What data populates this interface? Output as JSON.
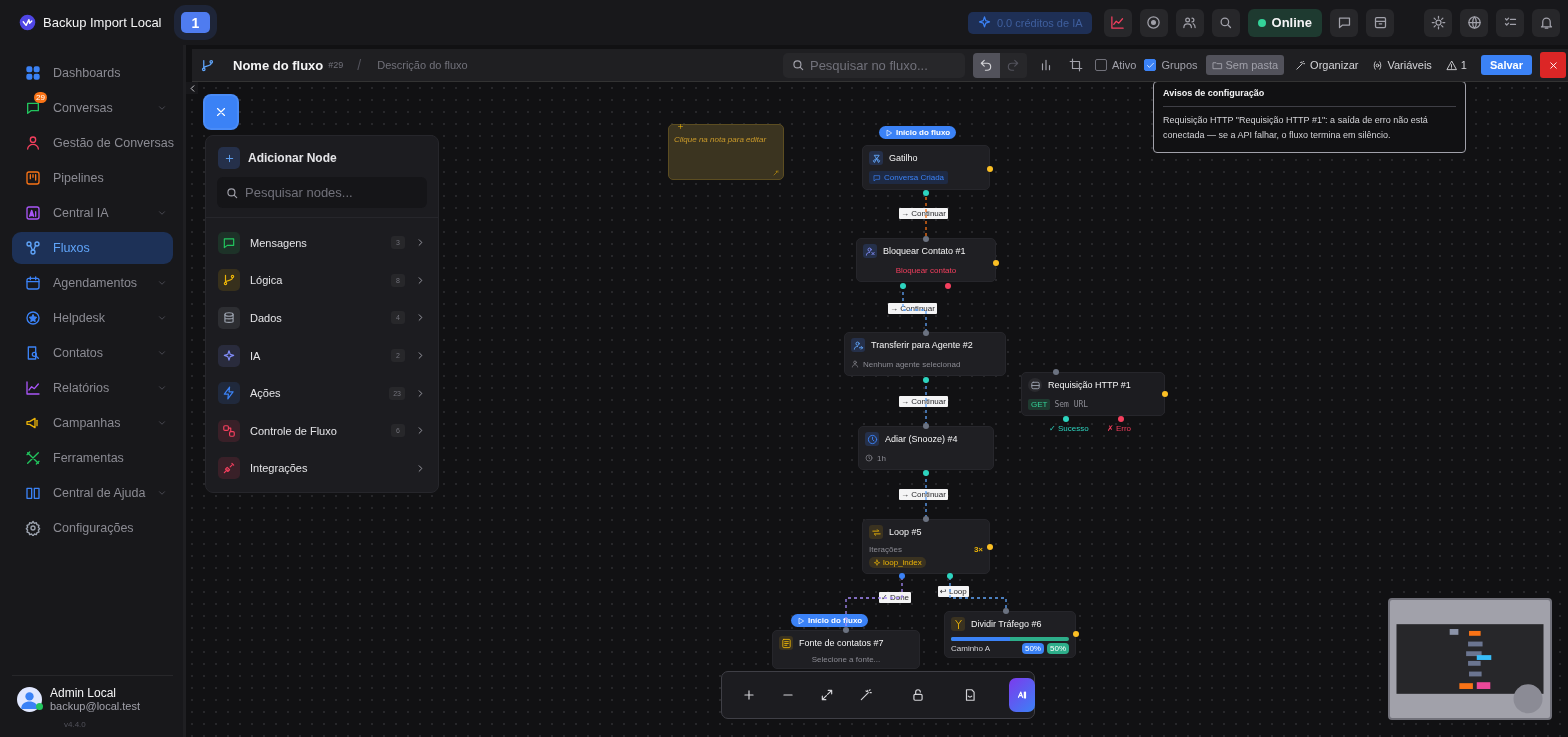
{
  "app": {
    "title": "Backup Import Local",
    "tab_badge": "1"
  },
  "topbar": {
    "credits": "0.0 créditos de IA",
    "status": "Online"
  },
  "sidebar": {
    "items": [
      {
        "label": "Dashboards",
        "expandable": false,
        "selected": false
      },
      {
        "label": "Conversas",
        "expandable": true,
        "selected": false,
        "badge": "29"
      },
      {
        "label": "Gestão de Conversas",
        "expandable": false,
        "selected": false
      },
      {
        "label": "Pipelines",
        "expandable": false,
        "selected": false
      },
      {
        "label": "Central IA",
        "expandable": true,
        "selected": false
      },
      {
        "label": "Fluxos",
        "expandable": false,
        "selected": true
      },
      {
        "label": "Agendamentos",
        "expandable": true,
        "selected": false
      },
      {
        "label": "Helpdesk",
        "expandable": true,
        "selected": false
      },
      {
        "label": "Contatos",
        "expandable": true,
        "selected": false
      },
      {
        "label": "Relatórios",
        "expandable": true,
        "selected": false
      },
      {
        "label": "Campanhas",
        "expandable": true,
        "selected": false
      },
      {
        "label": "Ferramentas",
        "expandable": false,
        "selected": false
      },
      {
        "label": "Central de Ajuda",
        "expandable": true,
        "selected": false
      },
      {
        "label": "Configurações",
        "expandable": false,
        "selected": false
      }
    ],
    "user": {
      "name": "Admin Local",
      "email": "backup@local.test",
      "version": "v4.4.0"
    }
  },
  "toolbar": {
    "flow_name": "Nome do fluxo",
    "flow_id": "#29",
    "separator": "/",
    "description_placeholder": "Descrição do fluxo",
    "search_placeholder": "Pesquisar no fluxo...",
    "active": {
      "label": "Ativo",
      "checked": false
    },
    "groups": {
      "label": "Grupos",
      "checked": true
    },
    "folder": "Sem pasta",
    "organize": "Organizar",
    "variables": "Variáveis",
    "warnings": "1",
    "save": "Salvar"
  },
  "warning_popup": {
    "title": "Avisos de configuração",
    "message": "Requisição HTTP \"Requisição HTTP #1\": a saída de erro não está conectada — se a API falhar, o fluxo termina em silêncio."
  },
  "node_panel": {
    "title": "Adicionar Node",
    "search_placeholder": "Pesquisar nodes...",
    "categories": [
      {
        "label": "Mensagens",
        "count": "3"
      },
      {
        "label": "Lógica",
        "count": "8"
      },
      {
        "label": "Dados",
        "count": "4"
      },
      {
        "label": "IA",
        "count": "2"
      },
      {
        "label": "Ações",
        "count": "23"
      },
      {
        "label": "Controle de Fluxo",
        "count": "6"
      },
      {
        "label": "Integrações"
      }
    ]
  },
  "canvas": {
    "note": "Clique na nota para editar",
    "nodes": [
      {
        "kind": "trigger",
        "title": "Gatilho",
        "start_label": "Início do fluxo",
        "tag": "Conversa Criada"
      },
      {
        "kind": "action",
        "title": "Bloquear Contato #1",
        "detail": "Bloquear contato"
      },
      {
        "kind": "transfer",
        "title": "Transferir para Agente #2",
        "detail": "Nenhum agente selecionad"
      },
      {
        "kind": "http",
        "title": "Requisição HTTP #1",
        "method": "GET",
        "detail": "Sem URL",
        "outputs": [
          "✓ Sucesso",
          "✗ Erro"
        ]
      },
      {
        "kind": "delay",
        "title": "Adiar (Snooze) #4",
        "detail": "1h"
      },
      {
        "kind": "loop",
        "title": "Loop #5",
        "label": "Iterações",
        "count": "3×",
        "variable": "loop_index"
      },
      {
        "kind": "source",
        "title": "Fonte de contatos #7",
        "start_label": "Início do fluxo",
        "detail": "Selecione a fonte..."
      },
      {
        "kind": "split",
        "title": "Dividir Tráfego #6",
        "path": "Caminho A",
        "level": 0.5,
        "shares": [
          "50%",
          "50%"
        ]
      }
    ],
    "edges": [
      {
        "label": "→ Continuar"
      },
      {
        "label": "→ Continuar"
      },
      {
        "label": "→ Continuar"
      },
      {
        "label": "→ Continuar"
      },
      {
        "label": "✓ Done"
      },
      {
        "label": "↩ Loop"
      }
    ]
  }
}
